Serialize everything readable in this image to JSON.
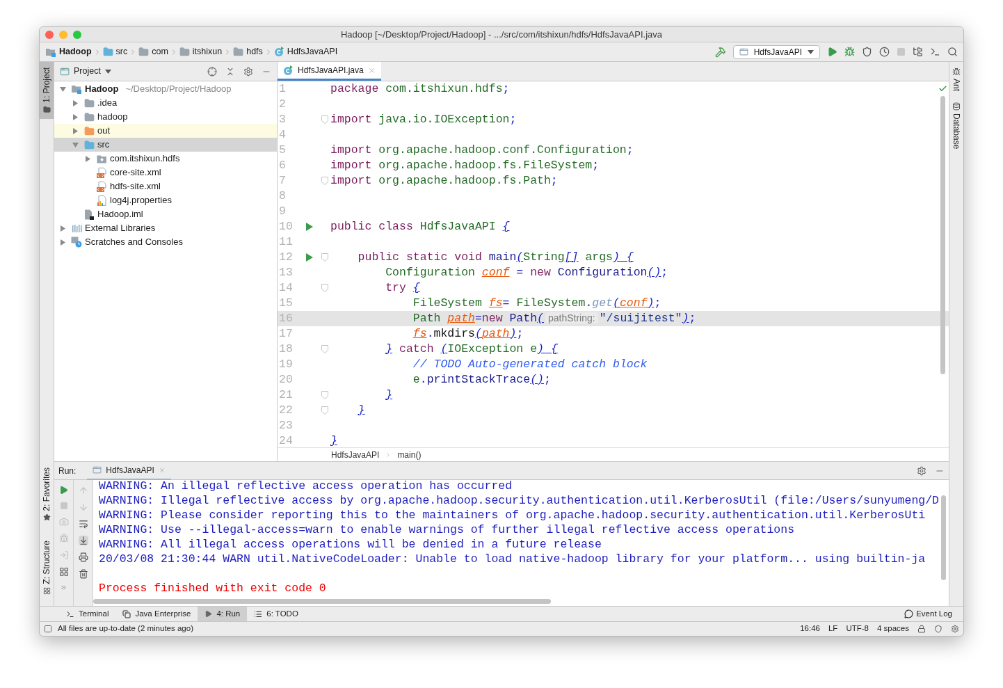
{
  "window": {
    "title": "Hadoop [~/Desktop/Project/Hadoop] - .../src/com/itshixun/hdfs/HdfsJavaAPI.java"
  },
  "navbar": [
    {
      "label": "Hadoop",
      "kind": "module"
    },
    {
      "label": "src",
      "kind": "source"
    },
    {
      "label": "com",
      "kind": "folder"
    },
    {
      "label": "itshixun",
      "kind": "folder"
    },
    {
      "label": "hdfs",
      "kind": "folder"
    },
    {
      "label": "HdfsJavaAPI",
      "kind": "class"
    }
  ],
  "run_config": {
    "label": "HdfsJavaAPI"
  },
  "left_strip": [
    {
      "label": "1: Project",
      "selected": true,
      "kind": "project"
    },
    {
      "label": "2: Favorites",
      "selected": false,
      "kind": "favorites"
    },
    {
      "label": "Z: Structure",
      "selected": false,
      "kind": "structure"
    }
  ],
  "right_strip": [
    {
      "label": "Ant",
      "kind": "ant"
    },
    {
      "label": "Database",
      "kind": "database"
    }
  ],
  "project_panel": {
    "title": "Project",
    "tree": [
      {
        "label": "Hadoop",
        "hint": "~/Desktop/Project/Hadoop",
        "kind": "module",
        "expanded": true,
        "selected": false,
        "children": [
          {
            "label": ".idea",
            "kind": "folder",
            "expanded": false,
            "selected": false
          },
          {
            "label": "hadoop",
            "kind": "folder",
            "expanded": false,
            "selected": false
          },
          {
            "label": "out",
            "kind": "excluded",
            "expanded": false,
            "selected": false
          },
          {
            "label": "src",
            "kind": "source",
            "expanded": true,
            "selected": true,
            "children": [
              {
                "label": "com.itshixun.hdfs",
                "kind": "package",
                "expanded": false,
                "selected": false
              },
              {
                "label": "core-site.xml",
                "kind": "xml",
                "selected": false
              },
              {
                "label": "hdfs-site.xml",
                "kind": "xml",
                "selected": false
              },
              {
                "label": "log4j.properties",
                "kind": "properties",
                "selected": false
              }
            ]
          },
          {
            "label": "Hadoop.iml",
            "kind": "iml",
            "selected": false
          }
        ]
      },
      {
        "label": "External Libraries",
        "kind": "library",
        "expanded": false,
        "selected": false
      },
      {
        "label": "Scratches and Consoles",
        "kind": "scratches",
        "expanded": false,
        "selected": false
      }
    ]
  },
  "editor": {
    "tabs": [
      {
        "label": "HdfsJavaAPI.java",
        "selected": true
      }
    ],
    "lines": [
      {
        "n": "1",
        "run": false,
        "fold": false,
        "current": false,
        "tokens": [
          {
            "kind": "kw",
            "text": "package "
          },
          {
            "kind": "pkg",
            "text": "com.itshixun.hdfs"
          },
          {
            "kind": "sym",
            "text": ";"
          }
        ]
      },
      {
        "n": "2",
        "run": false,
        "fold": false,
        "current": false
      },
      {
        "n": "3",
        "run": false,
        "fold": true,
        "current": false,
        "tokens": [
          {
            "kind": "kw",
            "text": "import "
          },
          {
            "kind": "pkg",
            "text": "java.io.IOException"
          },
          {
            "kind": "sym",
            "text": ";"
          }
        ]
      },
      {
        "n": "4",
        "run": false,
        "fold": false,
        "current": false
      },
      {
        "n": "5",
        "run": false,
        "fold": false,
        "current": false,
        "tokens": [
          {
            "kind": "kw",
            "text": "import "
          },
          {
            "kind": "pkg",
            "text": "org.apache.hadoop.conf.Configuration"
          },
          {
            "kind": "sym",
            "text": ";"
          }
        ]
      },
      {
        "n": "6",
        "run": false,
        "fold": false,
        "current": false,
        "tokens": [
          {
            "kind": "kw",
            "text": "import "
          },
          {
            "kind": "pkg",
            "text": "org.apache.hadoop.fs.FileSystem"
          },
          {
            "kind": "sym",
            "text": ";"
          }
        ]
      },
      {
        "n": "7",
        "run": false,
        "fold": true,
        "current": false,
        "tokens": [
          {
            "kind": "kw",
            "text": "import "
          },
          {
            "kind": "pkg",
            "text": "org.apache.hadoop.fs.Path"
          },
          {
            "kind": "sym",
            "text": ";"
          }
        ]
      },
      {
        "n": "8",
        "run": false,
        "fold": false,
        "current": false
      },
      {
        "n": "9",
        "run": false,
        "fold": false,
        "current": false
      },
      {
        "n": "10",
        "run": true,
        "fold": false,
        "current": false,
        "tokens": [
          {
            "kind": "kw",
            "text": "public class "
          },
          {
            "kind": "pkg",
            "text": "HdfsJavaAPI "
          },
          {
            "kind": "brace",
            "text": "{"
          }
        ]
      },
      {
        "n": "11",
        "run": false,
        "fold": false,
        "current": false
      },
      {
        "n": "12",
        "run": true,
        "fold": true,
        "current": false,
        "tokens": [
          {
            "kind": "kw",
            "text": "    public static void "
          },
          {
            "kind": "method",
            "text": "main"
          },
          {
            "kind": "brace",
            "text": "("
          },
          {
            "kind": "pkg",
            "text": "String"
          },
          {
            "kind": "brace",
            "text": "[]"
          },
          {
            "kind": "pkg",
            "text": " args"
          },
          {
            "kind": "brace",
            "text": ") {"
          }
        ]
      },
      {
        "n": "13",
        "run": false,
        "fold": false,
        "current": false,
        "tokens": [
          {
            "kind": "pkg",
            "text": "        Configuration "
          },
          {
            "kind": "var",
            "text": "conf"
          },
          {
            "kind": "sym",
            "text": " = "
          },
          {
            "kind": "kw",
            "text": "new "
          },
          {
            "kind": "method",
            "text": "Configuration"
          },
          {
            "kind": "brace",
            "text": "()"
          },
          {
            "kind": "sym",
            "text": ";"
          }
        ]
      },
      {
        "n": "14",
        "run": false,
        "fold": true,
        "current": false,
        "tokens": [
          {
            "kind": "kw",
            "text": "        try "
          },
          {
            "kind": "brace",
            "text": "{"
          }
        ]
      },
      {
        "n": "15",
        "run": false,
        "fold": false,
        "current": false,
        "tokens": [
          {
            "kind": "pkg",
            "text": "            FileSystem "
          },
          {
            "kind": "var",
            "text": "fs"
          },
          {
            "kind": "sym",
            "text": "= "
          },
          {
            "kind": "pkg",
            "text": "FileSystem"
          },
          {
            "kind": "sym",
            "text": "."
          },
          {
            "kind": "static",
            "text": "get"
          },
          {
            "kind": "brace",
            "text": "("
          },
          {
            "kind": "var",
            "text": "conf"
          },
          {
            "kind": "brace",
            "text": ")"
          },
          {
            "kind": "sym",
            "text": ";"
          }
        ]
      },
      {
        "n": "16",
        "run": false,
        "fold": false,
        "current": true,
        "tokens": [
          {
            "kind": "pkg",
            "text": "            Path "
          },
          {
            "kind": "var",
            "text": "path"
          },
          {
            "kind": "sym",
            "text": "="
          },
          {
            "kind": "kw",
            "text": "new "
          },
          {
            "kind": "method",
            "text": "Path"
          },
          {
            "kind": "brace",
            "text": "("
          },
          {
            "kind": "hint",
            "text": "pathString:"
          },
          {
            "kind": "str",
            "text": "\"/suijitest\""
          },
          {
            "kind": "brace",
            "text": ")"
          },
          {
            "kind": "sym",
            "text": ";"
          }
        ]
      },
      {
        "n": "17",
        "run": false,
        "fold": false,
        "current": false,
        "tokens": [
          {
            "kind": "var",
            "text": "            fs"
          },
          {
            "kind": "sym",
            "text": "."
          },
          {
            "kind": "plain",
            "text": "mkdirs"
          },
          {
            "kind": "brace",
            "text": "("
          },
          {
            "kind": "var",
            "text": "path"
          },
          {
            "kind": "brace",
            "text": ")"
          },
          {
            "kind": "sym",
            "text": ";"
          }
        ]
      },
      {
        "n": "18",
        "run": false,
        "fold": true,
        "current": false,
        "tokens": [
          {
            "kind": "brace",
            "text": "        }"
          },
          {
            "kind": "kw",
            "text": " catch "
          },
          {
            "kind": "brace",
            "text": "("
          },
          {
            "kind": "pkg",
            "text": "IOException e"
          },
          {
            "kind": "brace",
            "text": ") {"
          }
        ]
      },
      {
        "n": "19",
        "run": false,
        "fold": false,
        "current": false,
        "tokens": [
          {
            "kind": "comment",
            "text": "            // TODO Auto-generated catch block"
          }
        ]
      },
      {
        "n": "20",
        "run": false,
        "fold": false,
        "current": false,
        "tokens": [
          {
            "kind": "pkg",
            "text": "            e"
          },
          {
            "kind": "sym",
            "text": "."
          },
          {
            "kind": "method",
            "text": "printStackTrace"
          },
          {
            "kind": "brace",
            "text": "()"
          },
          {
            "kind": "sym",
            "text": ";"
          }
        ]
      },
      {
        "n": "21",
        "run": false,
        "fold": true,
        "current": false,
        "tokens": [
          {
            "kind": "brace",
            "text": "        }"
          }
        ]
      },
      {
        "n": "22",
        "run": false,
        "fold": true,
        "current": false,
        "tokens": [
          {
            "kind": "brace",
            "text": "    }"
          }
        ]
      },
      {
        "n": "23",
        "run": false,
        "fold": false,
        "current": false
      },
      {
        "n": "24",
        "run": false,
        "fold": false,
        "current": false,
        "tokens": [
          {
            "kind": "brace",
            "text": "}"
          }
        ]
      }
    ],
    "breadcrumbs": [
      "HdfsJavaAPI",
      "main()"
    ]
  },
  "run_panel": {
    "label": "Run:",
    "tabs": [
      {
        "label": "HdfsJavaAPI",
        "selected": true
      }
    ],
    "console": [
      {
        "kind": "warn",
        "text": "WARNING: An illegal reflective access operation has occurred"
      },
      {
        "kind": "warn",
        "text": "WARNING: Illegal reflective access by org.apache.hadoop.security.authentication.util.KerberosUtil (file:/Users/sunyumeng/D"
      },
      {
        "kind": "warn",
        "text": "WARNING: Please consider reporting this to the maintainers of org.apache.hadoop.security.authentication.util.KerberosUti"
      },
      {
        "kind": "warn",
        "text": "WARNING: Use --illegal-access=warn to enable warnings of further illegal reflective access operations"
      },
      {
        "kind": "warn",
        "text": "WARNING: All illegal access operations will be denied in a future release"
      },
      {
        "kind": "warn",
        "text": "20/03/08 21:30:44 WARN util.NativeCodeLoader: Unable to load native-hadoop library for your platform... using builtin-ja"
      },
      {
        "kind": "exit",
        "text": "Process finished with exit code 0"
      }
    ]
  },
  "tool_tabs": [
    {
      "label": "Terminal",
      "kind": "terminal",
      "selected": false
    },
    {
      "label": "Java Enterprise",
      "kind": "enterprise",
      "selected": false
    },
    {
      "label": "4: Run",
      "kind": "run",
      "selected": true
    },
    {
      "label": "6: TODO",
      "kind": "todo",
      "selected": false
    }
  ],
  "event_log": "Event Log",
  "status_bar": {
    "message": "All files are up-to-date (2 minutes ago)",
    "items": [
      "16:46",
      "LF",
      "UTF-8",
      "4 spaces"
    ]
  }
}
